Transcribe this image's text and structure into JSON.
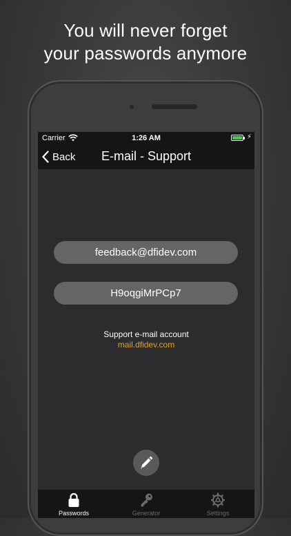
{
  "headline": {
    "line1": "You will never forget",
    "line2": "your passwords anymore"
  },
  "status_bar": {
    "carrier": "Carrier",
    "time": "1:26 AM",
    "battery_color": "#36d13f"
  },
  "nav": {
    "back_label": "Back",
    "title": "E-mail - Support"
  },
  "fields": {
    "email": "feedback@dfidev.com",
    "password": "H9oqgiMrPCp7"
  },
  "info": {
    "label": "Support e-mail account",
    "link": "mail.dfidev.com",
    "link_color": "#e8a21d"
  },
  "tabs": [
    {
      "label": "Passwords",
      "icon": "lock-icon",
      "active": true
    },
    {
      "label": "Generator",
      "icon": "key-icon",
      "active": false
    },
    {
      "label": "Settings",
      "icon": "gear-icon",
      "active": false
    }
  ]
}
